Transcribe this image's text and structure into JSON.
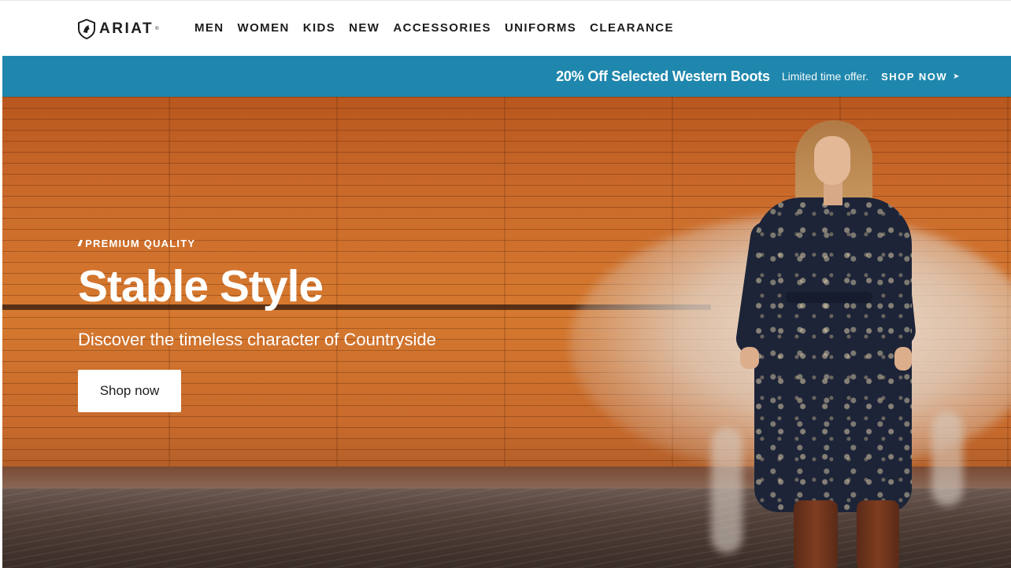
{
  "brand": {
    "name": "ARIAT",
    "tm": "®"
  },
  "nav": {
    "items": [
      {
        "label": "MEN"
      },
      {
        "label": "WOMEN"
      },
      {
        "label": "KIDS"
      },
      {
        "label": "NEW"
      },
      {
        "label": "ACCESSORIES"
      },
      {
        "label": "UNIFORMS"
      },
      {
        "label": "CLEARANCE"
      }
    ]
  },
  "promo": {
    "title": "20% Off Selected Western Boots",
    "subtitle": "Limited time offer.",
    "cta": "SHOP NOW",
    "background": "#1f87ad"
  },
  "hero": {
    "eyebrow_icon": "///",
    "eyebrow": "PREMIUM QUALITY",
    "title": "Stable Style",
    "subtitle": "Discover the timeless character of Countryside",
    "button": "Shop now"
  }
}
